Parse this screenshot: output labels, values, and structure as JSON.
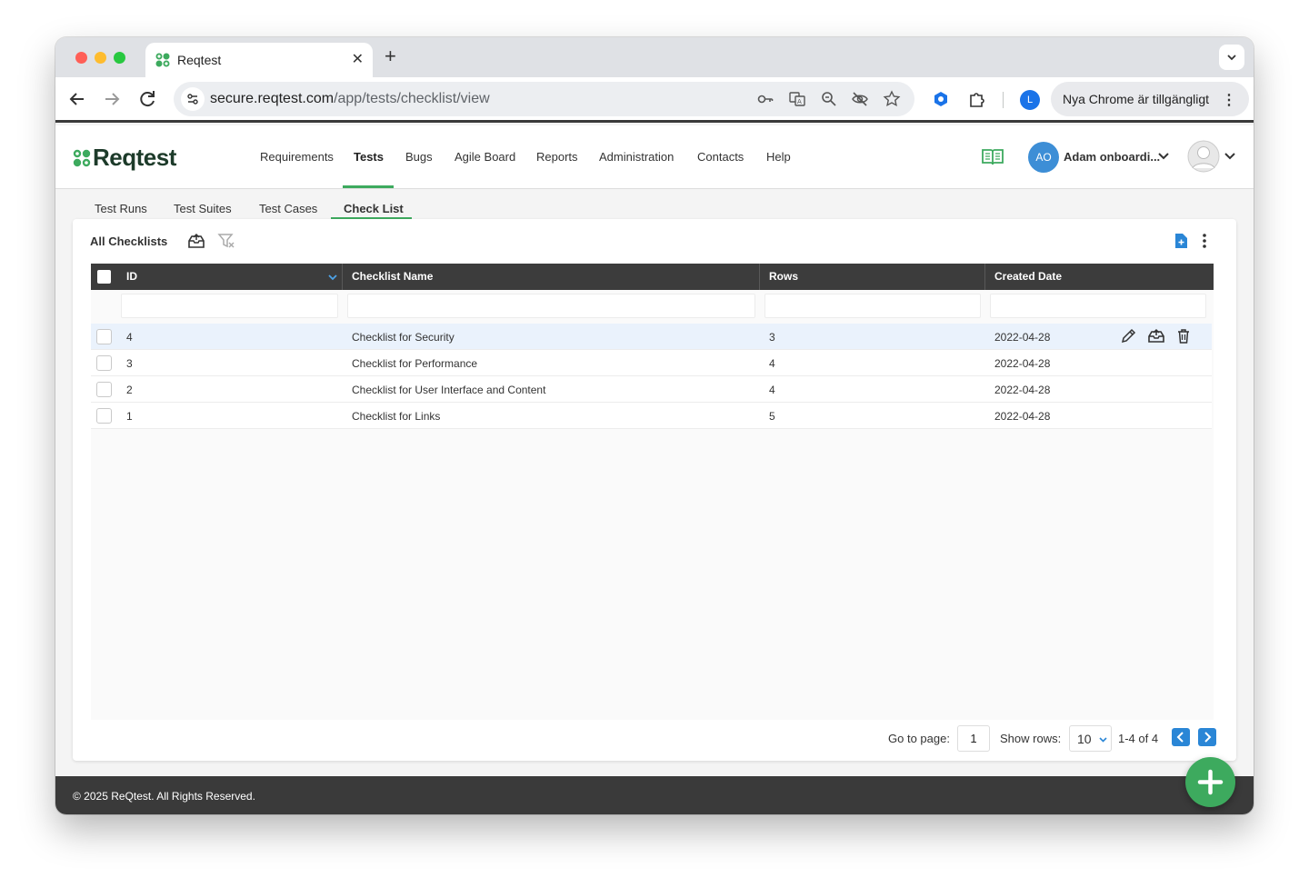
{
  "browser": {
    "tab_title": "Reqtest",
    "tab_close": "✕",
    "new_tab": "+",
    "url_host": "secure.reqtest.com",
    "url_path": "/app/tests/checklist/view",
    "profile_initial": "L",
    "update_text": "Nya Chrome är tillgängligt",
    "update_menu": "⋮"
  },
  "app": {
    "logo_text": "Reqtest",
    "nav": [
      {
        "label": "Requirements"
      },
      {
        "label": "Tests"
      },
      {
        "label": "Bugs"
      },
      {
        "label": "Agile Board"
      },
      {
        "label": "Reports"
      },
      {
        "label": "Administration"
      },
      {
        "label": "Contacts"
      },
      {
        "label": "Help"
      }
    ],
    "active_nav": "Tests",
    "user_initials": "AO",
    "user_name": "Adam onboardi..."
  },
  "subtabs": [
    {
      "label": "Test Runs"
    },
    {
      "label": "Test Suites"
    },
    {
      "label": "Test Cases"
    },
    {
      "label": "Check List"
    }
  ],
  "active_subtab": "Check List",
  "panel": {
    "title": "All Checklists"
  },
  "table": {
    "columns": [
      "ID",
      "Checklist Name",
      "Rows",
      "Created Date"
    ],
    "rows": [
      {
        "id": "4",
        "name": "Checklist for Security",
        "rows": "3",
        "created": "2022-04-28"
      },
      {
        "id": "3",
        "name": "Checklist for Performance",
        "rows": "4",
        "created": "2022-04-28"
      },
      {
        "id": "2",
        "name": "Checklist for User Interface and Content",
        "rows": "4",
        "created": "2022-04-28"
      },
      {
        "id": "1",
        "name": "Checklist for Links",
        "rows": "5",
        "created": "2022-04-28"
      }
    ]
  },
  "pager": {
    "go_to_page_label": "Go to page:",
    "page": "1",
    "show_rows_label": "Show rows:",
    "rows_per_page": "10",
    "range": "1-4 of 4"
  },
  "footer": {
    "text": "© 2025 ReQtest. All Rights Reserved."
  },
  "colors": {
    "accent_green": "#3daa5e",
    "accent_blue": "#2a86d6",
    "header_dark": "#3c3c3c",
    "highlight_row": "#eaf2fc"
  },
  "icons": [
    "lock-key-icon",
    "translate-icon",
    "zoom-icon",
    "eye-off-icon",
    "star-icon",
    "extension-icon",
    "puzzle-icon",
    "book-icon",
    "export-icon",
    "clear-filter-icon",
    "add-file-icon",
    "kebab-icon",
    "edit-icon",
    "archive-icon",
    "trash-icon",
    "plus-icon"
  ]
}
